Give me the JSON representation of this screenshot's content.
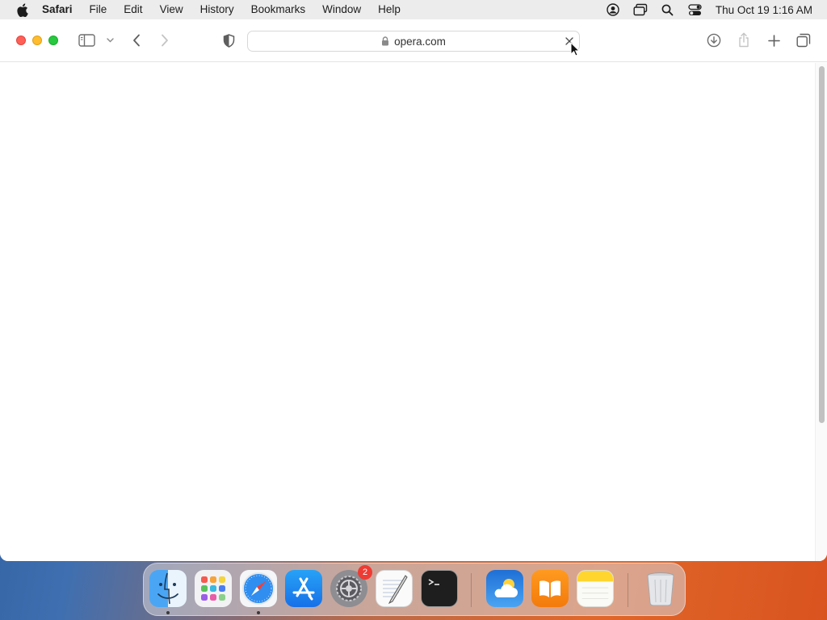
{
  "menubar": {
    "app_name": "Safari",
    "items": [
      "File",
      "Edit",
      "View",
      "History",
      "Bookmarks",
      "Window",
      "Help"
    ],
    "clock": "Thu Oct 19  1:16 AM",
    "status_icons": [
      "user-account-icon",
      "screen-mirroring-icon",
      "spotlight-search-icon",
      "control-center-icon"
    ]
  },
  "browser": {
    "url": "opera.com",
    "toolbar_icons": [
      "sidebar-icon",
      "chevron-down-icon",
      "back-icon",
      "forward-icon",
      "privacy-shield-icon",
      "download-icon",
      "share-icon",
      "new-tab-icon",
      "tab-overview-icon"
    ]
  },
  "dock": {
    "apps": [
      {
        "name": "Finder",
        "running": true
      },
      {
        "name": "Launchpad",
        "running": false
      },
      {
        "name": "Safari",
        "running": true
      },
      {
        "name": "App Store",
        "running": false
      },
      {
        "name": "System Settings",
        "running": false,
        "badge": "2"
      },
      {
        "name": "TextEdit",
        "running": false
      },
      {
        "name": "Terminal",
        "running": false
      },
      {
        "name": "Weather",
        "running": false
      },
      {
        "name": "Books",
        "running": false
      },
      {
        "name": "Notes",
        "running": false
      },
      {
        "name": "Trash",
        "running": false
      }
    ]
  },
  "colors": {
    "close": "#fe5f57",
    "minimize": "#febc2e",
    "maximize": "#28c840",
    "badge": "#ee3b33"
  }
}
